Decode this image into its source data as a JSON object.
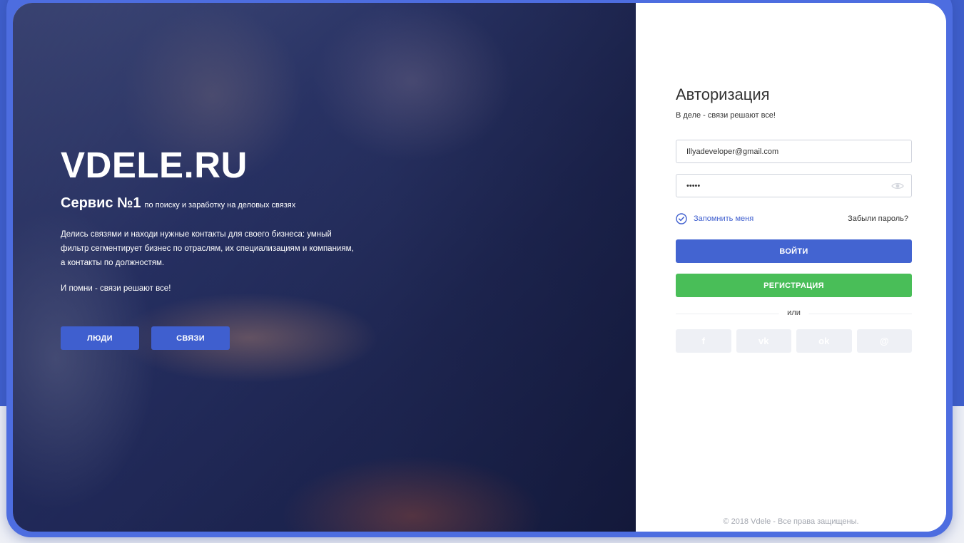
{
  "hero": {
    "brand": "VDELE.RU",
    "service_main": "Сервис №1",
    "service_sub": "по поиску и заработку на деловых связях",
    "description": "Делись связями и находи нужные контакты для своего бизнеса: умный фильтр сегментирует бизнес по отраслям, их специализациям и компаниям, а контакты по должностям.",
    "motto": "И помни - связи решают все!",
    "buttons": [
      "ЛЮДИ",
      "СВЯЗИ"
    ]
  },
  "auth": {
    "title": "Авторизация",
    "subtitle": "В деле - связи решают все!",
    "email_value": "Illyadeveloper@gmail.com",
    "password_value": "•••••",
    "remember_label": "Запомнить меня",
    "remember_checked": true,
    "forgot_label": "Забыли пароль?",
    "login_label": "ВОЙТИ",
    "register_label": "РЕГИСТРАЦИЯ",
    "or_label": "или",
    "socials": [
      {
        "icon": "facebook-icon",
        "glyph": "f"
      },
      {
        "icon": "vk-icon",
        "glyph": "vk"
      },
      {
        "icon": "odnoklassniki-icon",
        "glyph": "ok"
      },
      {
        "icon": "mail-ru-icon",
        "glyph": "@"
      }
    ]
  },
  "footer": "© 2018 Vdele - Все права защищены.",
  "colors": {
    "accent": "#4364d1",
    "success": "#49be58",
    "frame": "#4d6de0"
  }
}
